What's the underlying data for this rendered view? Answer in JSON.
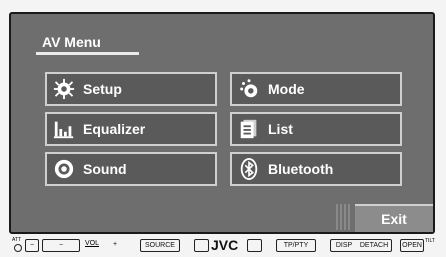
{
  "menu": {
    "title": "AV Menu",
    "buttons": [
      {
        "label": "Setup",
        "icon": "gear-icon"
      },
      {
        "label": "Mode",
        "icon": "mode-icon"
      },
      {
        "label": "Equalizer",
        "icon": "equalizer-icon"
      },
      {
        "label": "List",
        "icon": "list-icon"
      },
      {
        "label": "Sound",
        "icon": "sound-icon"
      },
      {
        "label": "Bluetooth",
        "icon": "bluetooth-icon"
      }
    ],
    "exit_label": "Exit"
  },
  "hardware": {
    "att_label": "ATT",
    "vol_label": "VOL",
    "minus": "−",
    "plus": "+",
    "source_label": "SOURCE",
    "brand": "JVC",
    "tp_label": "TP/PTY",
    "disp_label": "DISP",
    "detach_label": "DETACH",
    "open_label": "OPEN",
    "tilt_label": "TILT"
  },
  "colors": {
    "screen_bg": "#6e6e6e",
    "button_bg": "#5a5a5a",
    "button_border": "#cfcfcf",
    "text": "#ffffff"
  }
}
